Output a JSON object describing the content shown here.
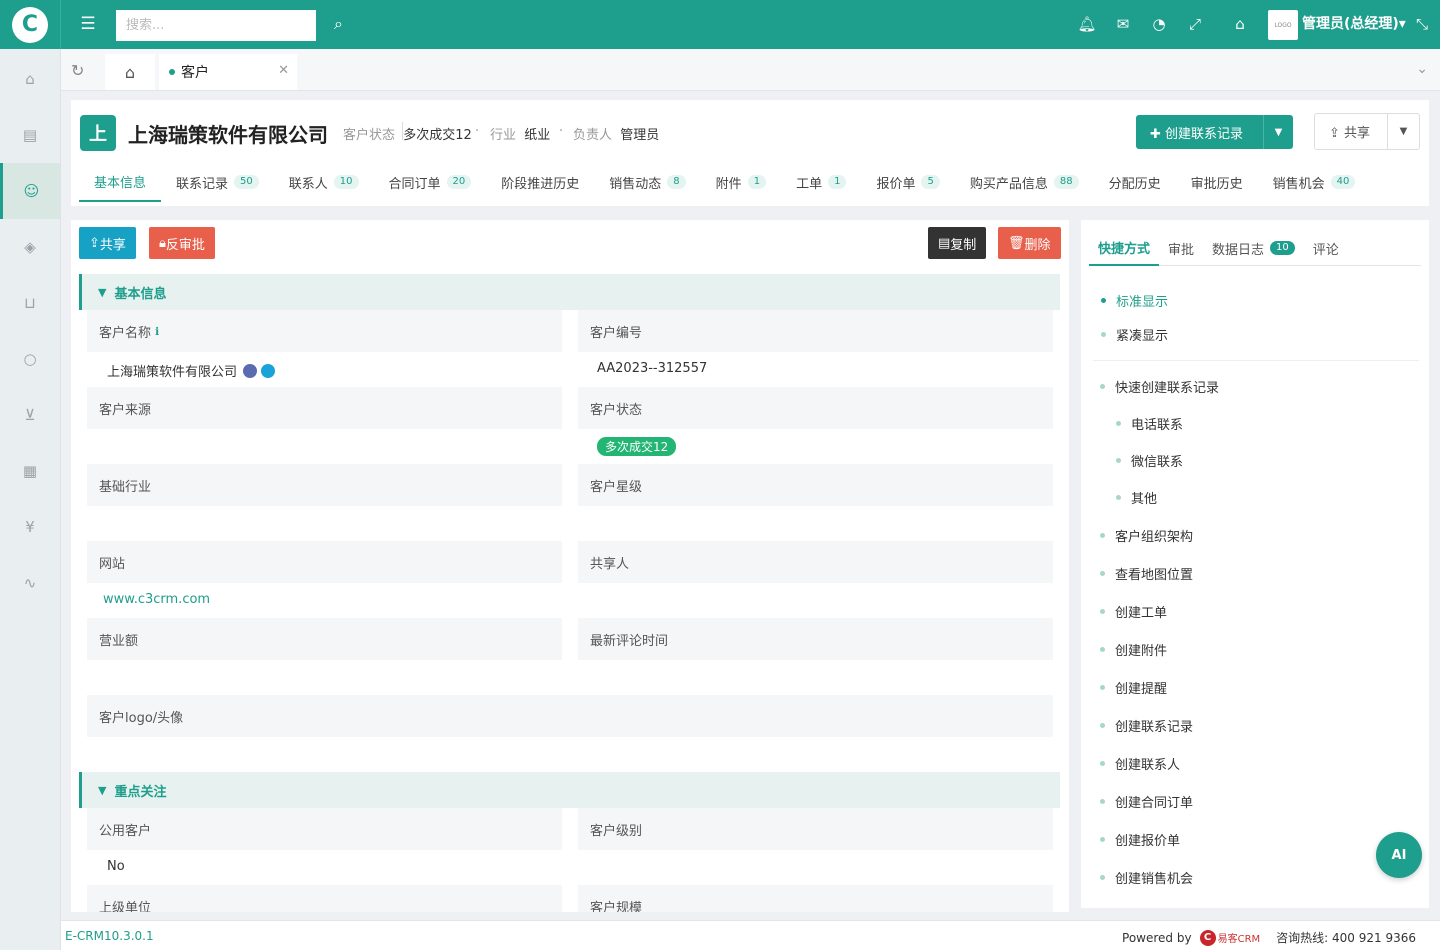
{
  "topbar": {
    "search_placeholder": "搜索...",
    "user": "管理员(总经理)▾",
    "avatar_text": "LOGO"
  },
  "tabs": {
    "current": "客户"
  },
  "header": {
    "badge": "上",
    "company": "上海瑞策软件有限公司",
    "meta": [
      {
        "k": "客户状态",
        "v": "多次成交12"
      },
      {
        "k": "行业",
        "v": "纸业"
      },
      {
        "k": "负责人",
        "v": "管理员"
      }
    ],
    "create_btn": "✚ 创建联系记录",
    "share_btn": "⇪ 共享"
  },
  "nav": [
    {
      "label": "基本信息",
      "count": ""
    },
    {
      "label": "联系记录",
      "count": "50"
    },
    {
      "label": "联系人",
      "count": "10"
    },
    {
      "label": "合同订单",
      "count": "20"
    },
    {
      "label": "阶段推进历史",
      "count": ""
    },
    {
      "label": "销售动态",
      "count": "8"
    },
    {
      "label": "附件",
      "count": "1"
    },
    {
      "label": "工单",
      "count": "1"
    },
    {
      "label": "报价单",
      "count": "5"
    },
    {
      "label": "购买产品信息",
      "count": "88"
    },
    {
      "label": "分配历史",
      "count": ""
    },
    {
      "label": "审批历史",
      "count": ""
    },
    {
      "label": "销售机会",
      "count": "40"
    }
  ],
  "actions": {
    "share": "共享",
    "unapprove": "反审批",
    "copy": "复制",
    "delete": "删除"
  },
  "section1": {
    "title": "基本信息",
    "fields": {
      "name_label": "客户名称",
      "name_value": "上海瑞策软件有限公司",
      "code_label": "客户编号",
      "code_value": "AA2023--312557",
      "source_label": "客户来源",
      "status_label": "客户状态",
      "status_value": "多次成交12",
      "industry_label": "基础行业",
      "star_label": "客户星级",
      "site_label": "网站",
      "site_value": "www.c3crm.com",
      "sharer_label": "共享人",
      "revenue_label": "营业额",
      "comment_label": "最新评论时间",
      "logo_label": "客户logo/头像"
    }
  },
  "section2": {
    "title": "重点关注",
    "fields": {
      "public_label": "公用客户",
      "public_value": "No",
      "level_label": "客户级别",
      "parent_label": "上级单位",
      "scale_label": "客户规模"
    }
  },
  "right": {
    "tabs": [
      {
        "label": "快捷方式",
        "count": ""
      },
      {
        "label": "审批",
        "count": ""
      },
      {
        "label": "数据日志",
        "count": "10"
      },
      {
        "label": "评论",
        "count": ""
      }
    ],
    "display": [
      "标准显示",
      "紧凑显示"
    ],
    "quick": "快速创建联系记录",
    "quick_sub": [
      "电话联系",
      "微信联系",
      "其他"
    ],
    "links": [
      "客户组织架构",
      "查看地图位置",
      "创建工单",
      "创建附件",
      "创建提醒",
      "创建联系记录",
      "创建联系人",
      "创建合同订单",
      "创建报价单",
      "创建销售机会"
    ]
  },
  "ai": "AI",
  "footer": {
    "version": "E-CRM10.3.0.1",
    "powered": "Powered by",
    "brand": "易客CRM",
    "hotline": "咨询热线: 400 921 9366"
  },
  "colors": {
    "primary": "#1e9e8c",
    "cyan": "#17a2c5",
    "red": "#e8604c",
    "dark": "#333333"
  }
}
